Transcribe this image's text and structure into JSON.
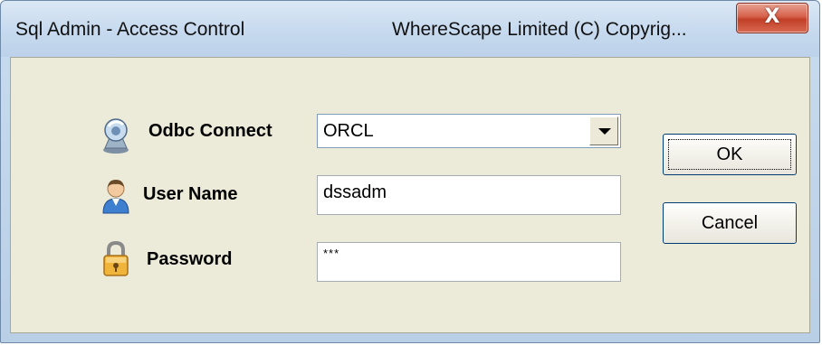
{
  "window": {
    "title": "Sql Admin - Access Control",
    "title_right": "WhereScape Limited  (C) Copyrig...",
    "close_glyph": "X"
  },
  "form": {
    "odbc": {
      "label": "Odbc Connect",
      "value": "ORCL",
      "icon": "database-icon"
    },
    "user": {
      "label": "User Name",
      "value": "dssadm",
      "icon": "user-icon"
    },
    "password": {
      "label": "Password",
      "value": "***",
      "icon": "lock-icon"
    }
  },
  "buttons": {
    "ok": "OK",
    "cancel": "Cancel"
  },
  "colors": {
    "client_background": "#ecead8",
    "close_button": "#c23f27",
    "title_gradient_top": "#dbe8f5"
  }
}
